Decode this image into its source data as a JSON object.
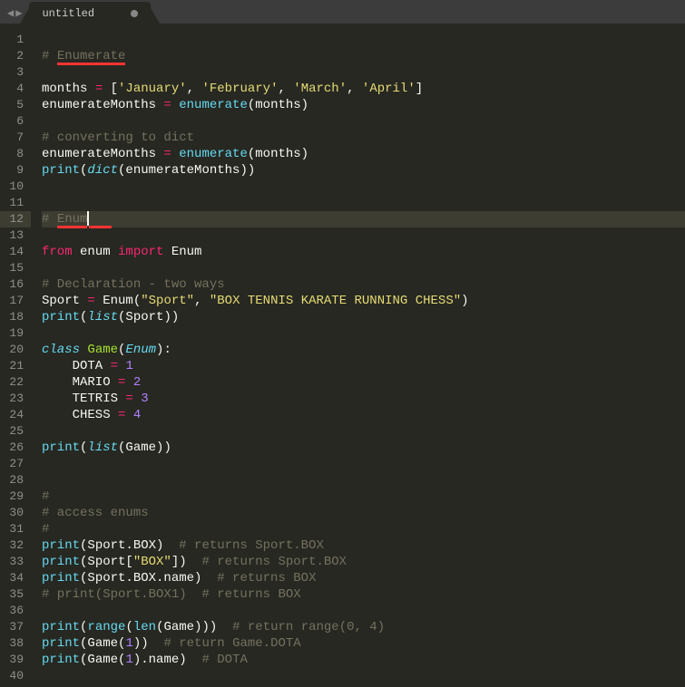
{
  "tab": {
    "title": "untitled",
    "dirty": true
  },
  "nav": {
    "back": "◀",
    "forward": "▶"
  },
  "current_line": 12,
  "code": [
    {
      "n": 1,
      "tokens": []
    },
    {
      "n": 2,
      "tokens": [
        {
          "cls": "c-comment",
          "t": "# "
        },
        {
          "cls": "c-comment underline-red",
          "t": "Enumerate"
        }
      ]
    },
    {
      "n": 3,
      "tokens": []
    },
    {
      "n": 4,
      "tokens": [
        {
          "cls": "c-plain",
          "t": "months "
        },
        {
          "cls": "c-op",
          "t": "="
        },
        {
          "cls": "c-plain",
          "t": " ["
        },
        {
          "cls": "c-string",
          "t": "'January'"
        },
        {
          "cls": "c-plain",
          "t": ", "
        },
        {
          "cls": "c-string",
          "t": "'February'"
        },
        {
          "cls": "c-plain",
          "t": ", "
        },
        {
          "cls": "c-string",
          "t": "'March'"
        },
        {
          "cls": "c-plain",
          "t": ", "
        },
        {
          "cls": "c-string",
          "t": "'April'"
        },
        {
          "cls": "c-plain",
          "t": "]"
        }
      ]
    },
    {
      "n": 5,
      "tokens": [
        {
          "cls": "c-plain",
          "t": "enumerateMonths "
        },
        {
          "cls": "c-op",
          "t": "="
        },
        {
          "cls": "c-plain",
          "t": " "
        },
        {
          "cls": "c-builtin",
          "t": "enumerate"
        },
        {
          "cls": "c-plain",
          "t": "(months)"
        }
      ]
    },
    {
      "n": 6,
      "tokens": []
    },
    {
      "n": 7,
      "tokens": [
        {
          "cls": "c-comment",
          "t": "# converting to dict"
        }
      ]
    },
    {
      "n": 8,
      "tokens": [
        {
          "cls": "c-plain",
          "t": "enumerateMonths "
        },
        {
          "cls": "c-op",
          "t": "="
        },
        {
          "cls": "c-plain",
          "t": " "
        },
        {
          "cls": "c-builtin",
          "t": "enumerate"
        },
        {
          "cls": "c-plain",
          "t": "(months)"
        }
      ]
    },
    {
      "n": 9,
      "tokens": [
        {
          "cls": "c-builtin",
          "t": "print"
        },
        {
          "cls": "c-plain",
          "t": "("
        },
        {
          "cls": "c-type-it",
          "t": "dict"
        },
        {
          "cls": "c-plain",
          "t": "(enumerateMonths))"
        }
      ]
    },
    {
      "n": 10,
      "tokens": []
    },
    {
      "n": 11,
      "tokens": []
    },
    {
      "n": 12,
      "tokens": [
        {
          "cls": "c-comment",
          "t": "# "
        },
        {
          "cls": "c-comment underline-red",
          "t": "Enum   "
        }
      ],
      "cursor_after_index": 1,
      "cursor_text": "Enum"
    },
    {
      "n": 13,
      "tokens": []
    },
    {
      "n": 14,
      "tokens": [
        {
          "cls": "c-kw",
          "t": "from"
        },
        {
          "cls": "c-plain",
          "t": " enum "
        },
        {
          "cls": "c-kw",
          "t": "import"
        },
        {
          "cls": "c-plain",
          "t": " Enum"
        }
      ]
    },
    {
      "n": 15,
      "tokens": []
    },
    {
      "n": 16,
      "tokens": [
        {
          "cls": "c-comment",
          "t": "# Declaration - two ways"
        }
      ]
    },
    {
      "n": 17,
      "tokens": [
        {
          "cls": "c-plain",
          "t": "Sport "
        },
        {
          "cls": "c-op",
          "t": "="
        },
        {
          "cls": "c-plain",
          "t": " Enum("
        },
        {
          "cls": "c-string",
          "t": "\"Sport\""
        },
        {
          "cls": "c-plain",
          "t": ", "
        },
        {
          "cls": "c-string",
          "t": "\"BOX TENNIS KARATE RUNNING CHESS\""
        },
        {
          "cls": "c-plain",
          "t": ")"
        }
      ]
    },
    {
      "n": 18,
      "tokens": [
        {
          "cls": "c-builtin",
          "t": "print"
        },
        {
          "cls": "c-plain",
          "t": "("
        },
        {
          "cls": "c-type-it",
          "t": "list"
        },
        {
          "cls": "c-plain",
          "t": "(Sport))"
        }
      ]
    },
    {
      "n": 19,
      "tokens": []
    },
    {
      "n": 20,
      "tokens": [
        {
          "cls": "c-type-it",
          "t": "class"
        },
        {
          "cls": "c-plain",
          "t": " "
        },
        {
          "cls": "c-func",
          "t": "Game"
        },
        {
          "cls": "c-plain",
          "t": "("
        },
        {
          "cls": "c-type-it",
          "t": "Enum"
        },
        {
          "cls": "c-plain",
          "t": "):"
        }
      ]
    },
    {
      "n": 21,
      "tokens": [
        {
          "cls": "c-plain",
          "t": "    DOTA "
        },
        {
          "cls": "c-op",
          "t": "="
        },
        {
          "cls": "c-plain",
          "t": " "
        },
        {
          "cls": "c-num",
          "t": "1"
        }
      ]
    },
    {
      "n": 22,
      "tokens": [
        {
          "cls": "c-plain",
          "t": "    MARIO "
        },
        {
          "cls": "c-op",
          "t": "="
        },
        {
          "cls": "c-plain",
          "t": " "
        },
        {
          "cls": "c-num",
          "t": "2"
        }
      ]
    },
    {
      "n": 23,
      "tokens": [
        {
          "cls": "c-plain",
          "t": "    TETRIS "
        },
        {
          "cls": "c-op",
          "t": "="
        },
        {
          "cls": "c-plain",
          "t": " "
        },
        {
          "cls": "c-num",
          "t": "3"
        }
      ]
    },
    {
      "n": 24,
      "tokens": [
        {
          "cls": "c-plain",
          "t": "    CHESS "
        },
        {
          "cls": "c-op",
          "t": "="
        },
        {
          "cls": "c-plain",
          "t": " "
        },
        {
          "cls": "c-num",
          "t": "4"
        }
      ]
    },
    {
      "n": 25,
      "tokens": []
    },
    {
      "n": 26,
      "tokens": [
        {
          "cls": "c-builtin",
          "t": "print"
        },
        {
          "cls": "c-plain",
          "t": "("
        },
        {
          "cls": "c-type-it",
          "t": "list"
        },
        {
          "cls": "c-plain",
          "t": "(Game))"
        }
      ]
    },
    {
      "n": 27,
      "tokens": []
    },
    {
      "n": 28,
      "tokens": []
    },
    {
      "n": 29,
      "tokens": [
        {
          "cls": "c-comment",
          "t": "#"
        }
      ]
    },
    {
      "n": 30,
      "tokens": [
        {
          "cls": "c-comment",
          "t": "# access enums"
        }
      ]
    },
    {
      "n": 31,
      "tokens": [
        {
          "cls": "c-comment",
          "t": "#"
        }
      ]
    },
    {
      "n": 32,
      "tokens": [
        {
          "cls": "c-builtin",
          "t": "print"
        },
        {
          "cls": "c-plain",
          "t": "(Sport.BOX)  "
        },
        {
          "cls": "c-comment",
          "t": "# returns Sport.BOX"
        }
      ]
    },
    {
      "n": 33,
      "tokens": [
        {
          "cls": "c-builtin",
          "t": "print"
        },
        {
          "cls": "c-plain",
          "t": "(Sport["
        },
        {
          "cls": "c-string",
          "t": "\"BOX\""
        },
        {
          "cls": "c-plain",
          "t": "])  "
        },
        {
          "cls": "c-comment",
          "t": "# returns Sport.BOX"
        }
      ]
    },
    {
      "n": 34,
      "tokens": [
        {
          "cls": "c-builtin",
          "t": "print"
        },
        {
          "cls": "c-plain",
          "t": "(Sport.BOX.name)  "
        },
        {
          "cls": "c-comment",
          "t": "# returns BOX"
        }
      ]
    },
    {
      "n": 35,
      "tokens": [
        {
          "cls": "c-comment",
          "t": "# print(Sport.BOX1)  # returns BOX"
        }
      ]
    },
    {
      "n": 36,
      "tokens": []
    },
    {
      "n": 37,
      "tokens": [
        {
          "cls": "c-builtin",
          "t": "print"
        },
        {
          "cls": "c-plain",
          "t": "("
        },
        {
          "cls": "c-builtin",
          "t": "range"
        },
        {
          "cls": "c-plain",
          "t": "("
        },
        {
          "cls": "c-builtin",
          "t": "len"
        },
        {
          "cls": "c-plain",
          "t": "(Game)))  "
        },
        {
          "cls": "c-comment",
          "t": "# return range(0, 4)"
        }
      ]
    },
    {
      "n": 38,
      "tokens": [
        {
          "cls": "c-builtin",
          "t": "print"
        },
        {
          "cls": "c-plain",
          "t": "(Game("
        },
        {
          "cls": "c-num",
          "t": "1"
        },
        {
          "cls": "c-plain",
          "t": "))  "
        },
        {
          "cls": "c-comment",
          "t": "# return Game.DOTA"
        }
      ]
    },
    {
      "n": 39,
      "tokens": [
        {
          "cls": "c-builtin",
          "t": "print"
        },
        {
          "cls": "c-plain",
          "t": "(Game("
        },
        {
          "cls": "c-num",
          "t": "1"
        },
        {
          "cls": "c-plain",
          "t": ").name)  "
        },
        {
          "cls": "c-comment",
          "t": "# DOTA"
        }
      ]
    },
    {
      "n": 40,
      "tokens": []
    }
  ]
}
